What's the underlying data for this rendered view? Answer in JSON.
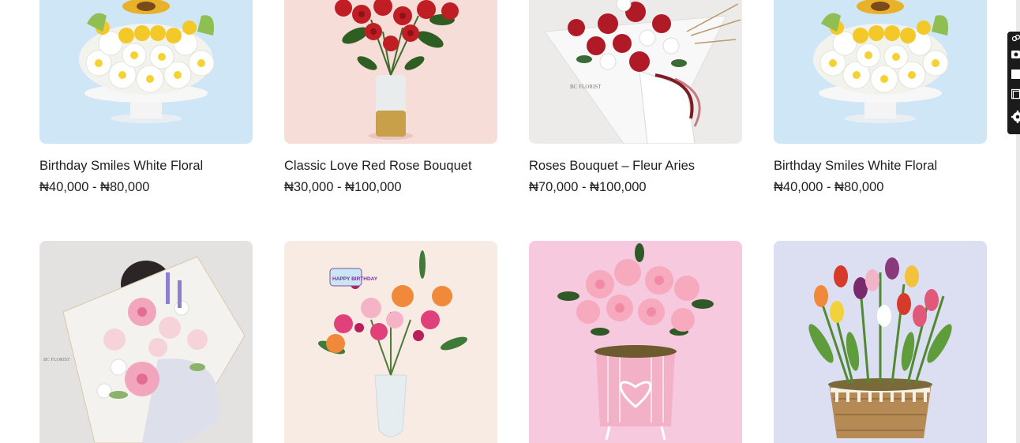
{
  "products": [
    {
      "name": "Birthday Smiles White Floral",
      "price": "₦40,000 - ₦80,000",
      "image": "white-daisy-cake-arrangement",
      "bg": "#cfe6f6"
    },
    {
      "name": "Classic Love Red Rose Bouquet",
      "price": "₦30,000 - ₦100,000",
      "image": "red-roses-in-vase",
      "bg": "#f6ddd8"
    },
    {
      "name": "Roses Bouquet – Fleur Aries",
      "price": "₦70,000 - ₦100,000",
      "image": "wrapped-rose-bouquet",
      "bg": "#ecebea"
    },
    {
      "name": "Birthday Smiles White Floral",
      "price": "₦40,000 - ₦80,000",
      "image": "white-daisy-cake-arrangement",
      "bg": "#cfe6f6"
    },
    {
      "name": "",
      "price": "",
      "image": "pastel-bouquet-held",
      "bg": "#e4e2e1"
    },
    {
      "name": "",
      "price": "",
      "image": "birthday-mixed-bouquet-vase",
      "bg": "#f7ebe4"
    },
    {
      "name": "",
      "price": "",
      "image": "pink-azalea-heart-pot",
      "bg": "#f6c9de"
    },
    {
      "name": "",
      "price": "",
      "image": "tulips-basket",
      "bg": "#dcdff1"
    }
  ],
  "brand_watermark": "BC FLORIST",
  "birthday_pick_text": "HAPPY BIRTHDAY",
  "side_toolbar": [
    "link-icon",
    "camera-icon",
    "rectangle-icon",
    "window-icon",
    "gear-icon"
  ]
}
